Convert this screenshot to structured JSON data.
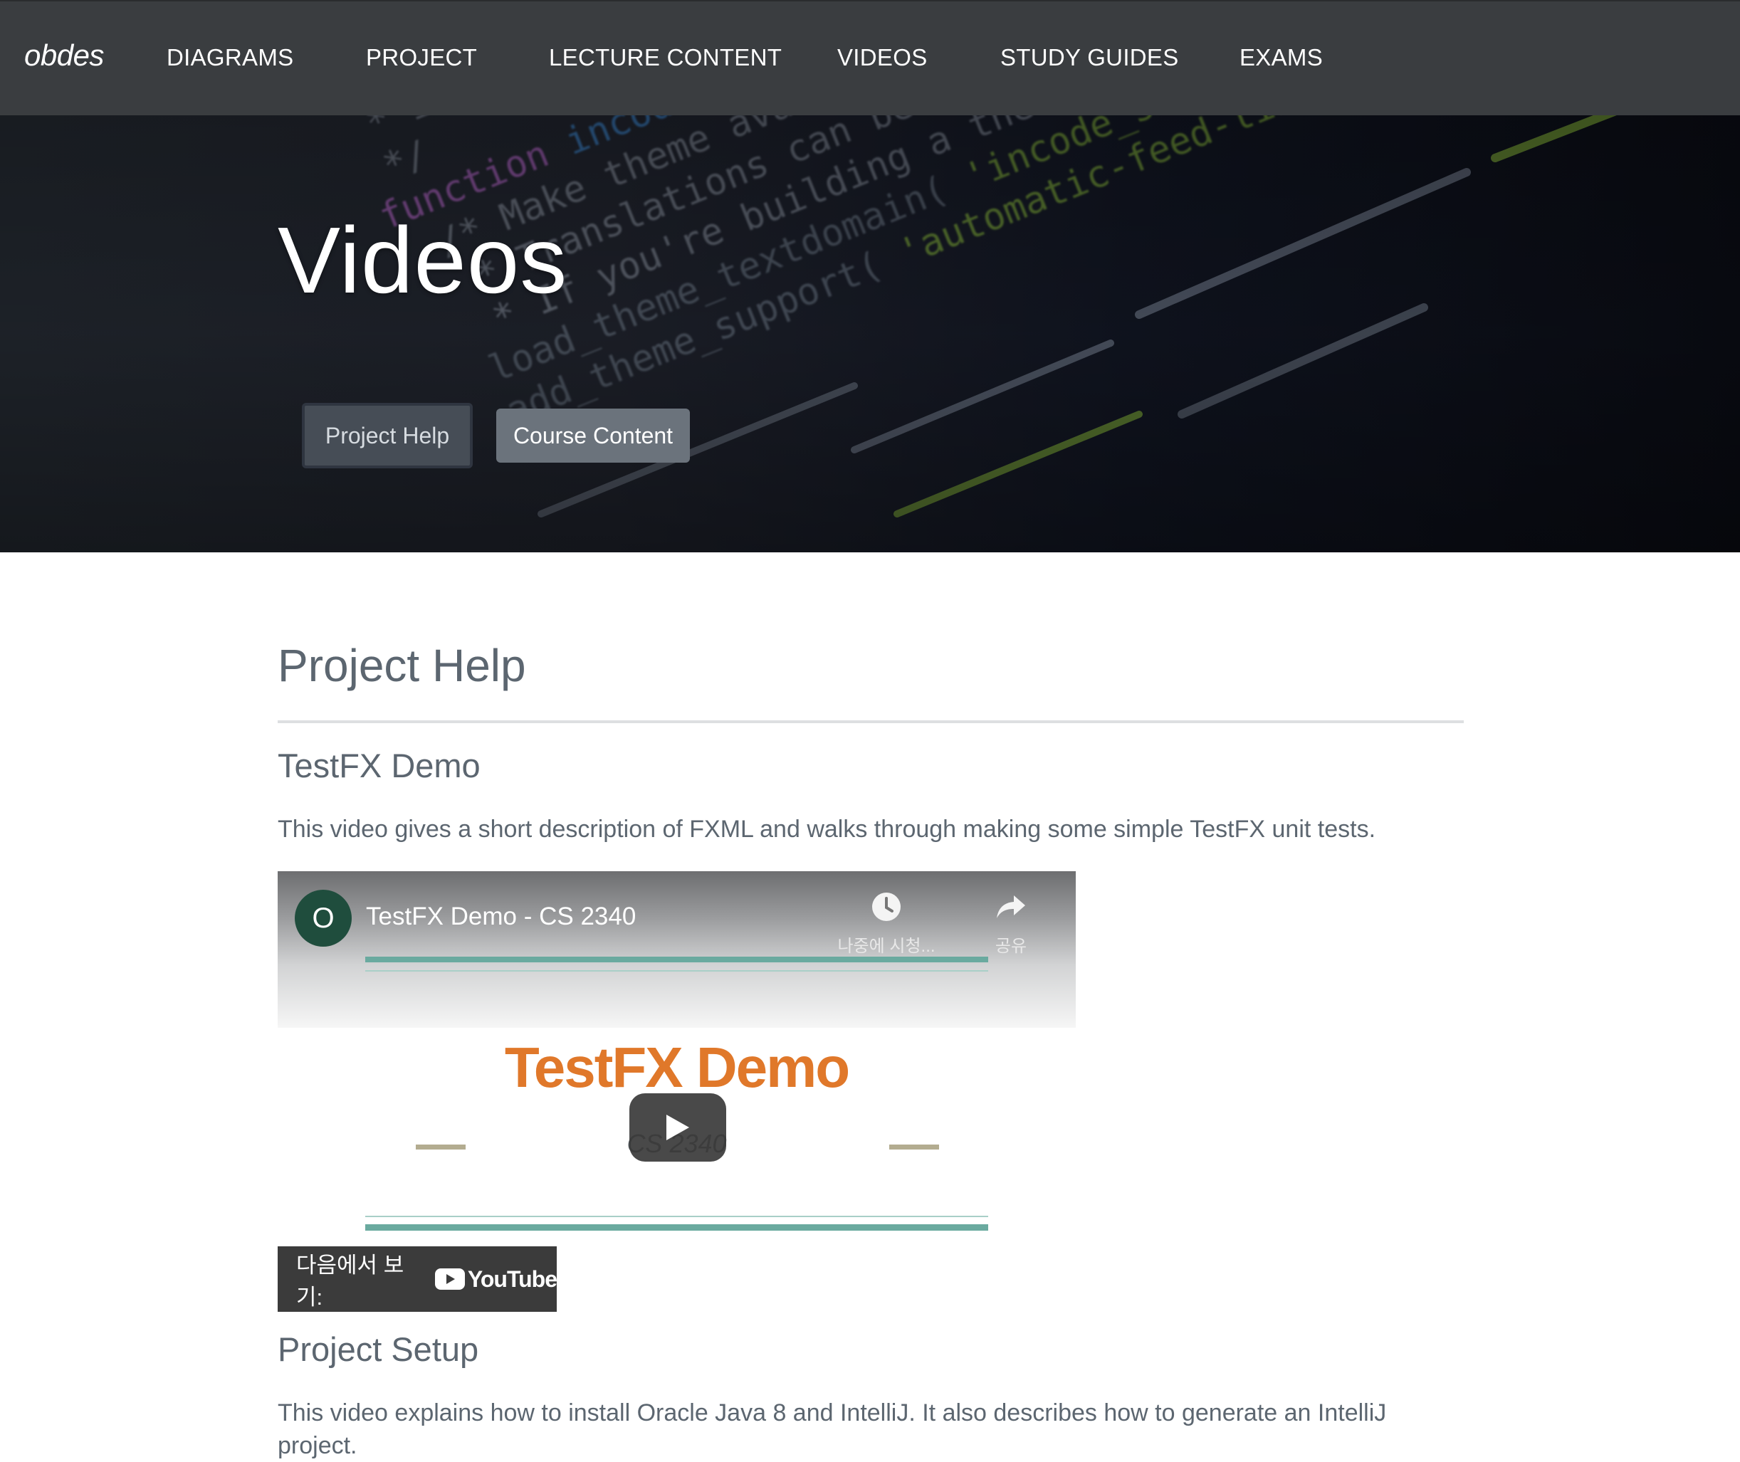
{
  "nav": {
    "brand": "obdes",
    "links": [
      "DIAGRAMS",
      "PROJECT",
      "LECTURE CONTENT",
      "VIDEOS",
      "STUDY GUIDES",
      "EXAMS"
    ]
  },
  "hero": {
    "title": "Videos",
    "buttons": {
      "project_help": "Project Help",
      "course_content": "Course Content"
    }
  },
  "section": {
    "title": "Project Help",
    "videos": [
      {
        "heading": "TestFX Demo",
        "description": "This video gives a short description of FXML and walks through making some simple TestFX unit tests.",
        "embed": {
          "channel_initial": "O",
          "title": "TestFX Demo - CS 2340",
          "watch_later": "나중에 시청...",
          "share": "공유",
          "slide_title": "TestFX Demo",
          "slide_subtitle": "CS 2340",
          "watch_on": "다음에서 보기:",
          "youtube": "YouTube"
        }
      },
      {
        "heading": "Project Setup",
        "description": "This video explains how to install Oracle Java 8 and IntelliJ. It also describes how to generate an IntelliJ project."
      }
    ]
  },
  "colors": {
    "navbar": "#3a3d40",
    "accent_orange": "#e0782a",
    "teal": "#6aaa9f",
    "channel_avatar": "#1f4d3d"
  }
}
